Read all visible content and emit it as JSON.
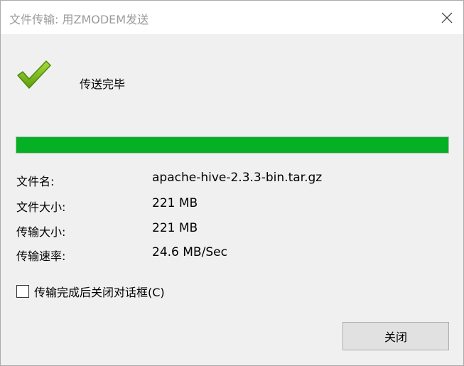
{
  "window": {
    "title": "文件传输: 用ZMODEM发送"
  },
  "status": {
    "text": "传送完毕"
  },
  "progress": {
    "percent": 100,
    "fill_color": "#06b025"
  },
  "info": [
    {
      "label": "文件名:",
      "value": "apache-hive-2.3.3-bin.tar.gz"
    },
    {
      "label": "文件大小:",
      "value": "221 MB"
    },
    {
      "label": "传输大小:",
      "value": "221 MB"
    },
    {
      "label": "传输速率:",
      "value": "24.6 MB/Sec"
    }
  ],
  "options": {
    "close_after_transfer_label": "传输完成后关闭对话框(C)",
    "close_after_transfer_checked": false
  },
  "buttons": {
    "close_label": "关闭"
  },
  "icons": {
    "status": "checkmark-icon",
    "window_close": "close-icon"
  }
}
